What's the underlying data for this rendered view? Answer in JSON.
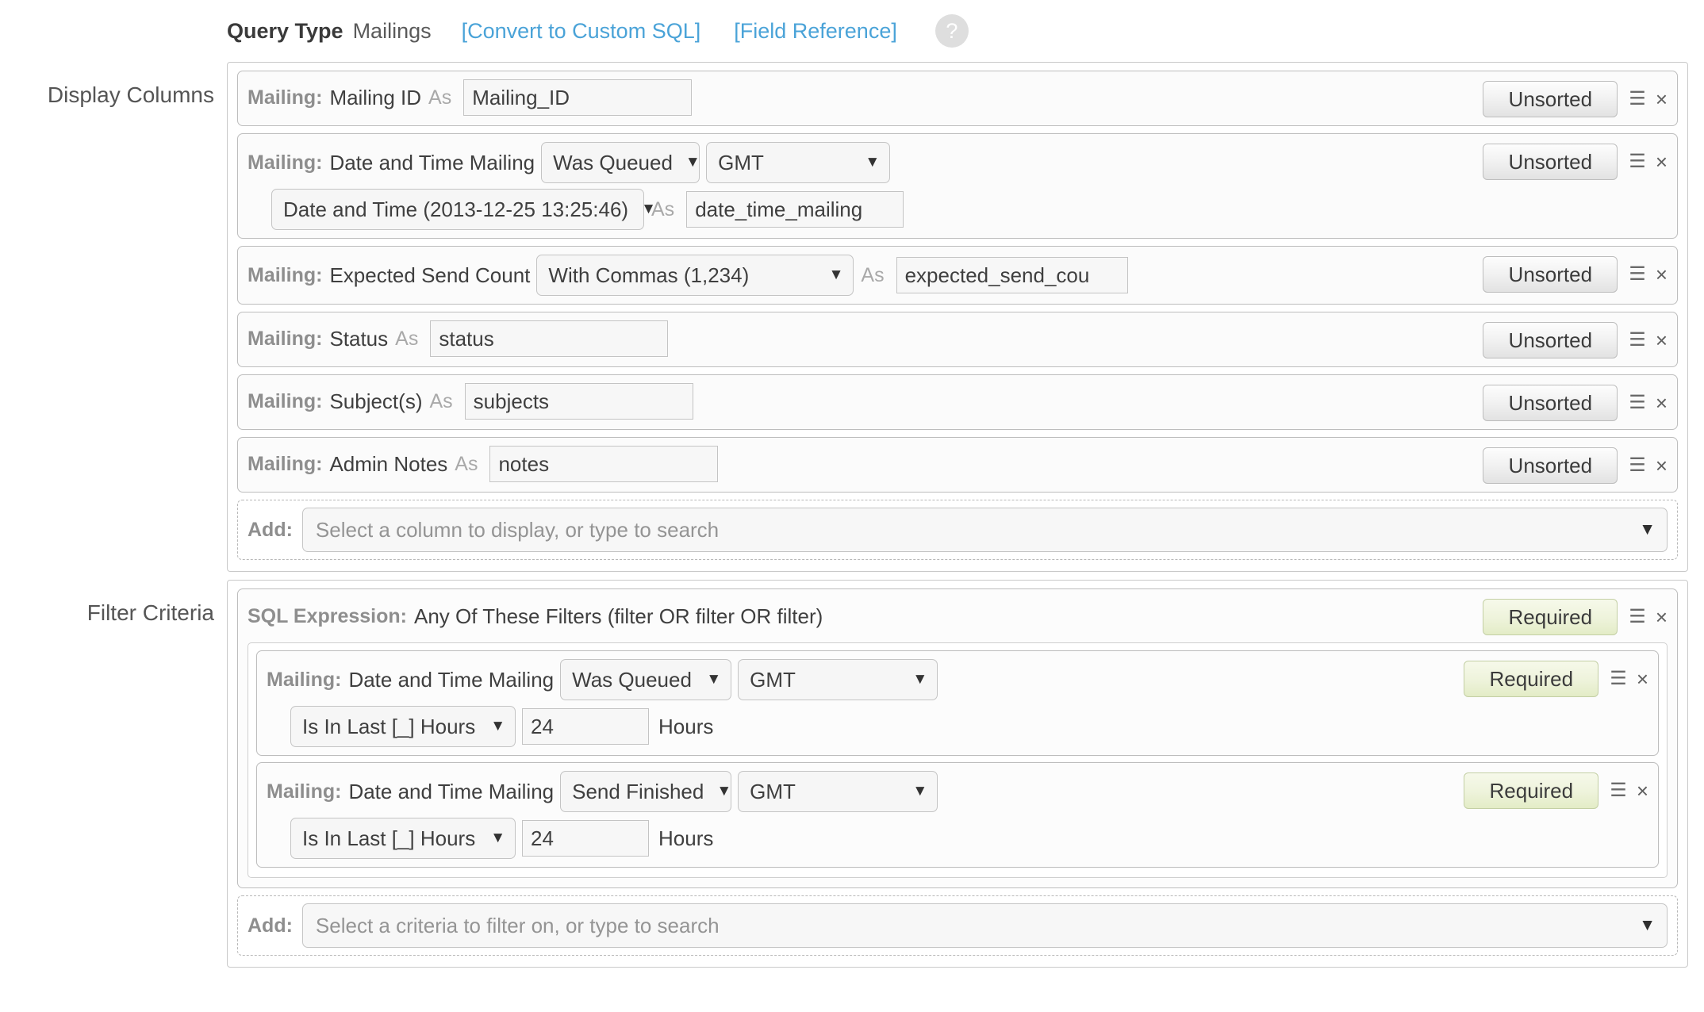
{
  "header": {
    "query_type_label": "Query Type",
    "query_type_value": "Mailings",
    "convert_link": "[Convert to Custom SQL]",
    "field_reference_link": "[Field Reference]",
    "help_glyph": "?",
    "help_icon": "question-mark-icon"
  },
  "icons": {
    "caret_down": "▼",
    "drag_handle": "☰",
    "close": "×"
  },
  "display_columns": {
    "label": "Display Columns",
    "rows": [
      {
        "table": "Mailing:",
        "field": "Mailing ID",
        "as_word": "As",
        "alias": "Mailing_ID",
        "sort": "Unsorted"
      },
      {
        "table": "Mailing:",
        "field": "Date and Time Mailing",
        "status_select": "Was Queued",
        "timezone_select": "GMT",
        "format_select": "Date and Time (2013-12-25 13:25:46)",
        "as_word": "As",
        "alias": "date_time_mailing",
        "sort": "Unsorted"
      },
      {
        "table": "Mailing:",
        "field": "Expected Send Count",
        "format_select": "With Commas (1,234)",
        "as_word": "As",
        "alias": "expected_send_cou",
        "sort": "Unsorted"
      },
      {
        "table": "Mailing:",
        "field": "Status",
        "as_word": "As",
        "alias": "status",
        "sort": "Unsorted"
      },
      {
        "table": "Mailing:",
        "field": "Subject(s)",
        "as_word": "As",
        "alias": "subjects",
        "sort": "Unsorted"
      },
      {
        "table": "Mailing:",
        "field": "Admin Notes",
        "as_word": "As",
        "alias": "notes",
        "sort": "Unsorted"
      }
    ],
    "add": {
      "label": "Add:",
      "placeholder": "Select a column to display, or type to search"
    }
  },
  "filter_criteria": {
    "label": "Filter Criteria",
    "expression": {
      "prefix": "SQL Expression:",
      "text": "Any Of These Filters (filter OR filter OR filter)",
      "required": "Required",
      "children": [
        {
          "table": "Mailing:",
          "field": "Date and Time Mailing",
          "status_select": "Was Queued",
          "timezone_select": "GMT",
          "operator_select": "Is In Last [_] Hours",
          "value": "24",
          "unit": "Hours",
          "required": "Required"
        },
        {
          "table": "Mailing:",
          "field": "Date and Time Mailing",
          "status_select": "Send Finished",
          "timezone_select": "GMT",
          "operator_select": "Is In Last [_] Hours",
          "value": "24",
          "unit": "Hours",
          "required": "Required"
        }
      ]
    },
    "add": {
      "label": "Add:",
      "placeholder": "Select a criteria to filter on, or type to search"
    }
  },
  "colors": {
    "link": "#4aa3d8",
    "required_badge": "#e3ecc6",
    "panel_border": "#c9c9c9"
  }
}
